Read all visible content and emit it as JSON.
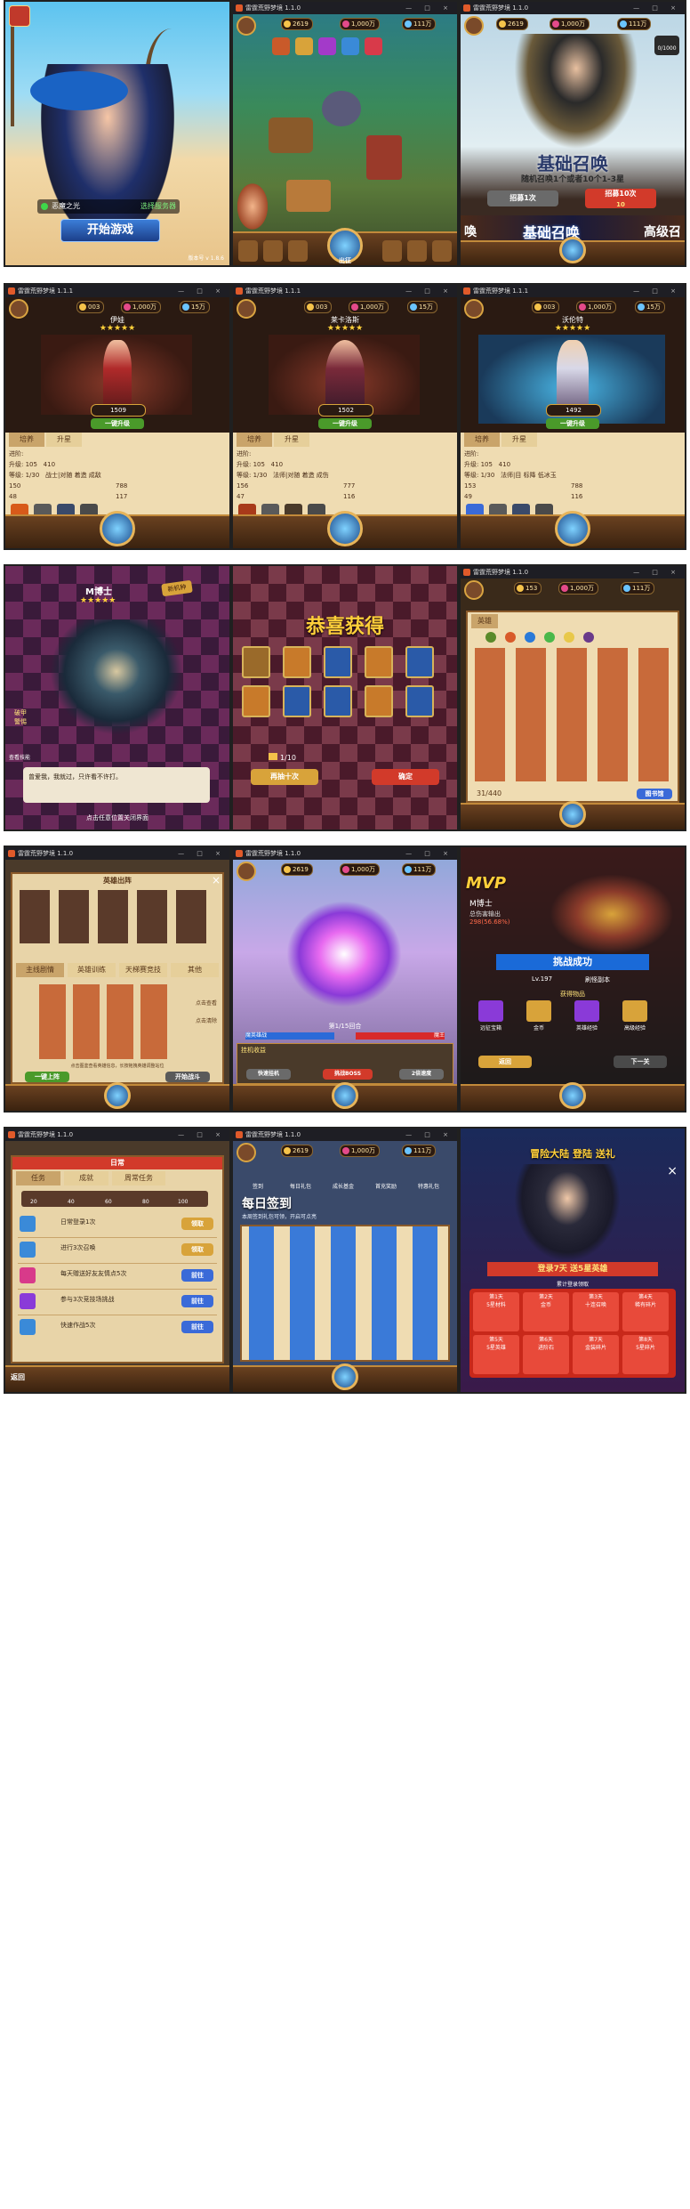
{
  "topbar": {
    "window_title": "雷霆荒野梦境 1.1.0",
    "window_title_b": "雷霆荒野梦境 1.1.1",
    "controls": "— □ ×"
  },
  "row1": {
    "login": {
      "server_name": "恶魔之光",
      "server_button": "选择服务器",
      "start_button": "开始游戏",
      "version": "版本号 v 1.8.6"
    },
    "map": {
      "level_badge": "Lv 2",
      "gold": "2619",
      "diamond": "1,000万",
      "currency3": "111万",
      "nav_center": "出征"
    },
    "summon": {
      "title": "基础召唤",
      "subtitle": "随机召唤1个或者10个1-3星",
      "btn_once": "招募1次",
      "btn_ten": "招募10次",
      "cost_ten": "10",
      "banner_left": "喚",
      "banner_center": "基础召唤",
      "banner_right": "高级召",
      "corner_count": "0/1000",
      "gold": "2619",
      "diamond": "1,000万",
      "currency3": "111万"
    }
  },
  "row2": {
    "hero_panels": [
      {
        "name": "伊娃",
        "power": "1509",
        "btn_action": "一键升级",
        "tab1": "培养",
        "tab2": "升星",
        "progress_label": "进阶:",
        "level_label": "升级:",
        "level_cost_1": "105",
        "level_cost_2": "410",
        "rank_label": "等级: 1/30",
        "skill_desc": "战士|对随 着造 成敌",
        "stats": [
          "150",
          "788",
          "48",
          "117"
        ]
      },
      {
        "name": "莱卡洛斯",
        "power": "1502",
        "btn_action": "一键升级",
        "tab1": "培养",
        "tab2": "升星",
        "progress_label": "进阶:",
        "level_label": "升级:",
        "level_cost_1": "105",
        "level_cost_2": "410",
        "rank_label": "等级: 1/30",
        "skill_desc": "法师|对随 着造 成伤",
        "stats": [
          "156",
          "777",
          "47",
          "116"
        ]
      },
      {
        "name": "沃伦特",
        "power": "1492",
        "btn_action": "一键升级",
        "tab1": "培养",
        "tab2": "升星",
        "progress_label": "进阶:",
        "level_label": "升级:",
        "level_cost_1": "105",
        "level_cost_2": "410",
        "rank_label": "等级: 1/30",
        "skill_desc": "法师|目 标降 低冰玉",
        "stats": [
          "153",
          "788",
          "49",
          "116"
        ]
      }
    ],
    "topbar_gold": "003",
    "topbar_diamond": "1,000万",
    "topbar_c3": "15万"
  },
  "row3": {
    "boss": {
      "name": "M博士",
      "tag": "新机种",
      "side_label": "破甲警惕",
      "side_label2": "查看技能",
      "dialog": "曾爱我，我就过，只许看不许打。",
      "footer": "点击任意位置关闭界面"
    },
    "reward": {
      "title": "恭喜获得",
      "count": "1/10",
      "btn_again": "再抽十次",
      "btn_ok": "确定"
    },
    "roster": {
      "tab_hero": "英雄",
      "count": "31/440",
      "btn_book": "图书馆",
      "gold": "153",
      "diamond": "1,000万",
      "currency3": "111万"
    }
  },
  "row4": {
    "lineup": {
      "title": "英雄出阵",
      "tabs": [
        "主线剧情",
        "英雄训练",
        "天梯赛竞技",
        "其他"
      ],
      "btn_confirm": "一键上阵",
      "hint": "点击图鉴查看英雄信息，长按拖拽英雄调整站位",
      "btn_start": "开始战斗",
      "side_1": "点击查看",
      "side_2": "点击清除"
    },
    "battle": {
      "round": "第1/15回合",
      "player_name": "魔英雄战",
      "enemy_name": "魔王",
      "btn_auto": "挂机收益",
      "btn_skip": "挑战BOSS",
      "btn_speed": "2倍速度",
      "btn_left": "快速挂机",
      "gold": "2619",
      "diamond": "1,000万",
      "currency3": "111万"
    },
    "victory": {
      "mvp": "MVP",
      "hero_name": "M博士",
      "damage_label": "总伤害输出",
      "damage_value": "298(56.68%)",
      "banner": "挑战成功",
      "level": "Lv.197",
      "chapter": "刷怪副本",
      "reward_title": "获得物品",
      "items": [
        "远征宝箱",
        "金币",
        "英雄经验",
        "高级经验"
      ],
      "btn_left": "返回",
      "btn_right": "下一关"
    }
  },
  "row5": {
    "daily": {
      "title": "日常",
      "tabs": [
        "任务",
        "成就",
        "周常任务"
      ],
      "milestones": [
        "20",
        "40",
        "60",
        "80",
        "100"
      ],
      "tasks": [
        {
          "label": "日常登录1次",
          "btn": "领取"
        },
        {
          "label": "进行3次召唤",
          "btn": "领取"
        },
        {
          "label": "每天赠送好友友情点5次",
          "btn": "前往"
        },
        {
          "label": "参与3次竞技场挑战",
          "btn": "前往"
        },
        {
          "label": "快速作战5次",
          "btn": "前往"
        }
      ],
      "nav_label": "返回"
    },
    "signin": {
      "title": "每日签到",
      "subtitle": "本周签到礼包可领，开启可点亮",
      "top_tabs": [
        "签到",
        "每日礼包",
        "成长基金",
        "首充奖励",
        "特惠礼包"
      ],
      "gold": "2619",
      "diamond": "1,000万",
      "currency3": "111万"
    },
    "promo": {
      "title": "冒险大陆 登陆 送礼",
      "ribbon": "登录7天 送5星英雄",
      "sub": "累计登录领取",
      "days": [
        "第1天",
        "第2天",
        "第3天",
        "第4天",
        "第5天",
        "第6天",
        "第7天",
        "第8天"
      ],
      "items": [
        "5星材料",
        "金币",
        "十连召唤",
        "稀有碎片",
        "5星英雄",
        "进阶石",
        "金装碎片",
        "5星碎片"
      ]
    }
  },
  "colors": {
    "frame": "#202020",
    "gold": "#ffe37a",
    "red": "#d23a2a",
    "green": "#4a9a2a",
    "parchment": "#efdcb2"
  }
}
